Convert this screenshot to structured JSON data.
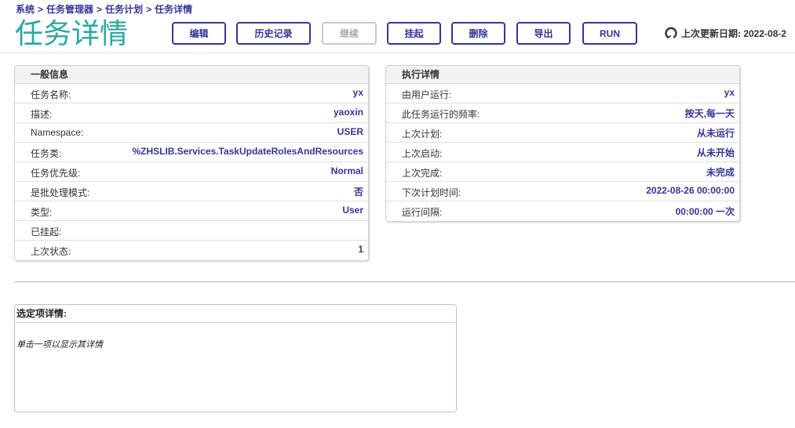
{
  "breadcrumb": [
    "系统",
    "任务管理器",
    "任务计划",
    "任务详情"
  ],
  "breadcrumb_sep": ">",
  "page_title": "任务详情",
  "toolbar": {
    "edit": "编辑",
    "history": "历史记录",
    "resume": "继续",
    "suspend": "挂起",
    "delete": "删除",
    "export": "导出",
    "run": "RUN"
  },
  "last_update": "上次更新日期: 2022-08-2",
  "general": {
    "title": "一般信息",
    "rows": [
      {
        "label": "任务名称:",
        "value": "yx"
      },
      {
        "label": "描述:",
        "value": "yaoxin"
      },
      {
        "label": "Namespace:",
        "value": "USER"
      },
      {
        "label": "任务类:",
        "value": "%ZHSLIB.Services.TaskUpdateRolesAndResources"
      },
      {
        "label": "任务优先级:",
        "value": "Normal"
      },
      {
        "label": "是批处理模式:",
        "value": "否"
      },
      {
        "label": "类型:",
        "value": "User"
      },
      {
        "label": "已挂起:",
        "value": ""
      },
      {
        "label": "上次状态:",
        "value": "1"
      }
    ]
  },
  "execution": {
    "title": "执行详情",
    "rows": [
      {
        "label": "由用户运行:",
        "value": "yx"
      },
      {
        "label": "此任务运行的频率:",
        "value": "按天,每一天"
      },
      {
        "label": "上次计划:",
        "value": "从未运行"
      },
      {
        "label": "上次启动:",
        "value": "从未开始"
      },
      {
        "label": "上次完成:",
        "value": "未完成"
      },
      {
        "label": "下次计划时间:",
        "value": "2022-08-26 00:00:00"
      },
      {
        "label": "运行间隔:",
        "value": "00:00:00 一次"
      }
    ]
  },
  "selected_detail": {
    "title": "选定项详情:",
    "hint": "单击一项以显示其详情"
  },
  "colors": {
    "accent": "#333695",
    "title": "#2aa8a0",
    "disabled": "#a8a8a8"
  },
  "icons": {
    "refresh": "refresh-icon"
  }
}
